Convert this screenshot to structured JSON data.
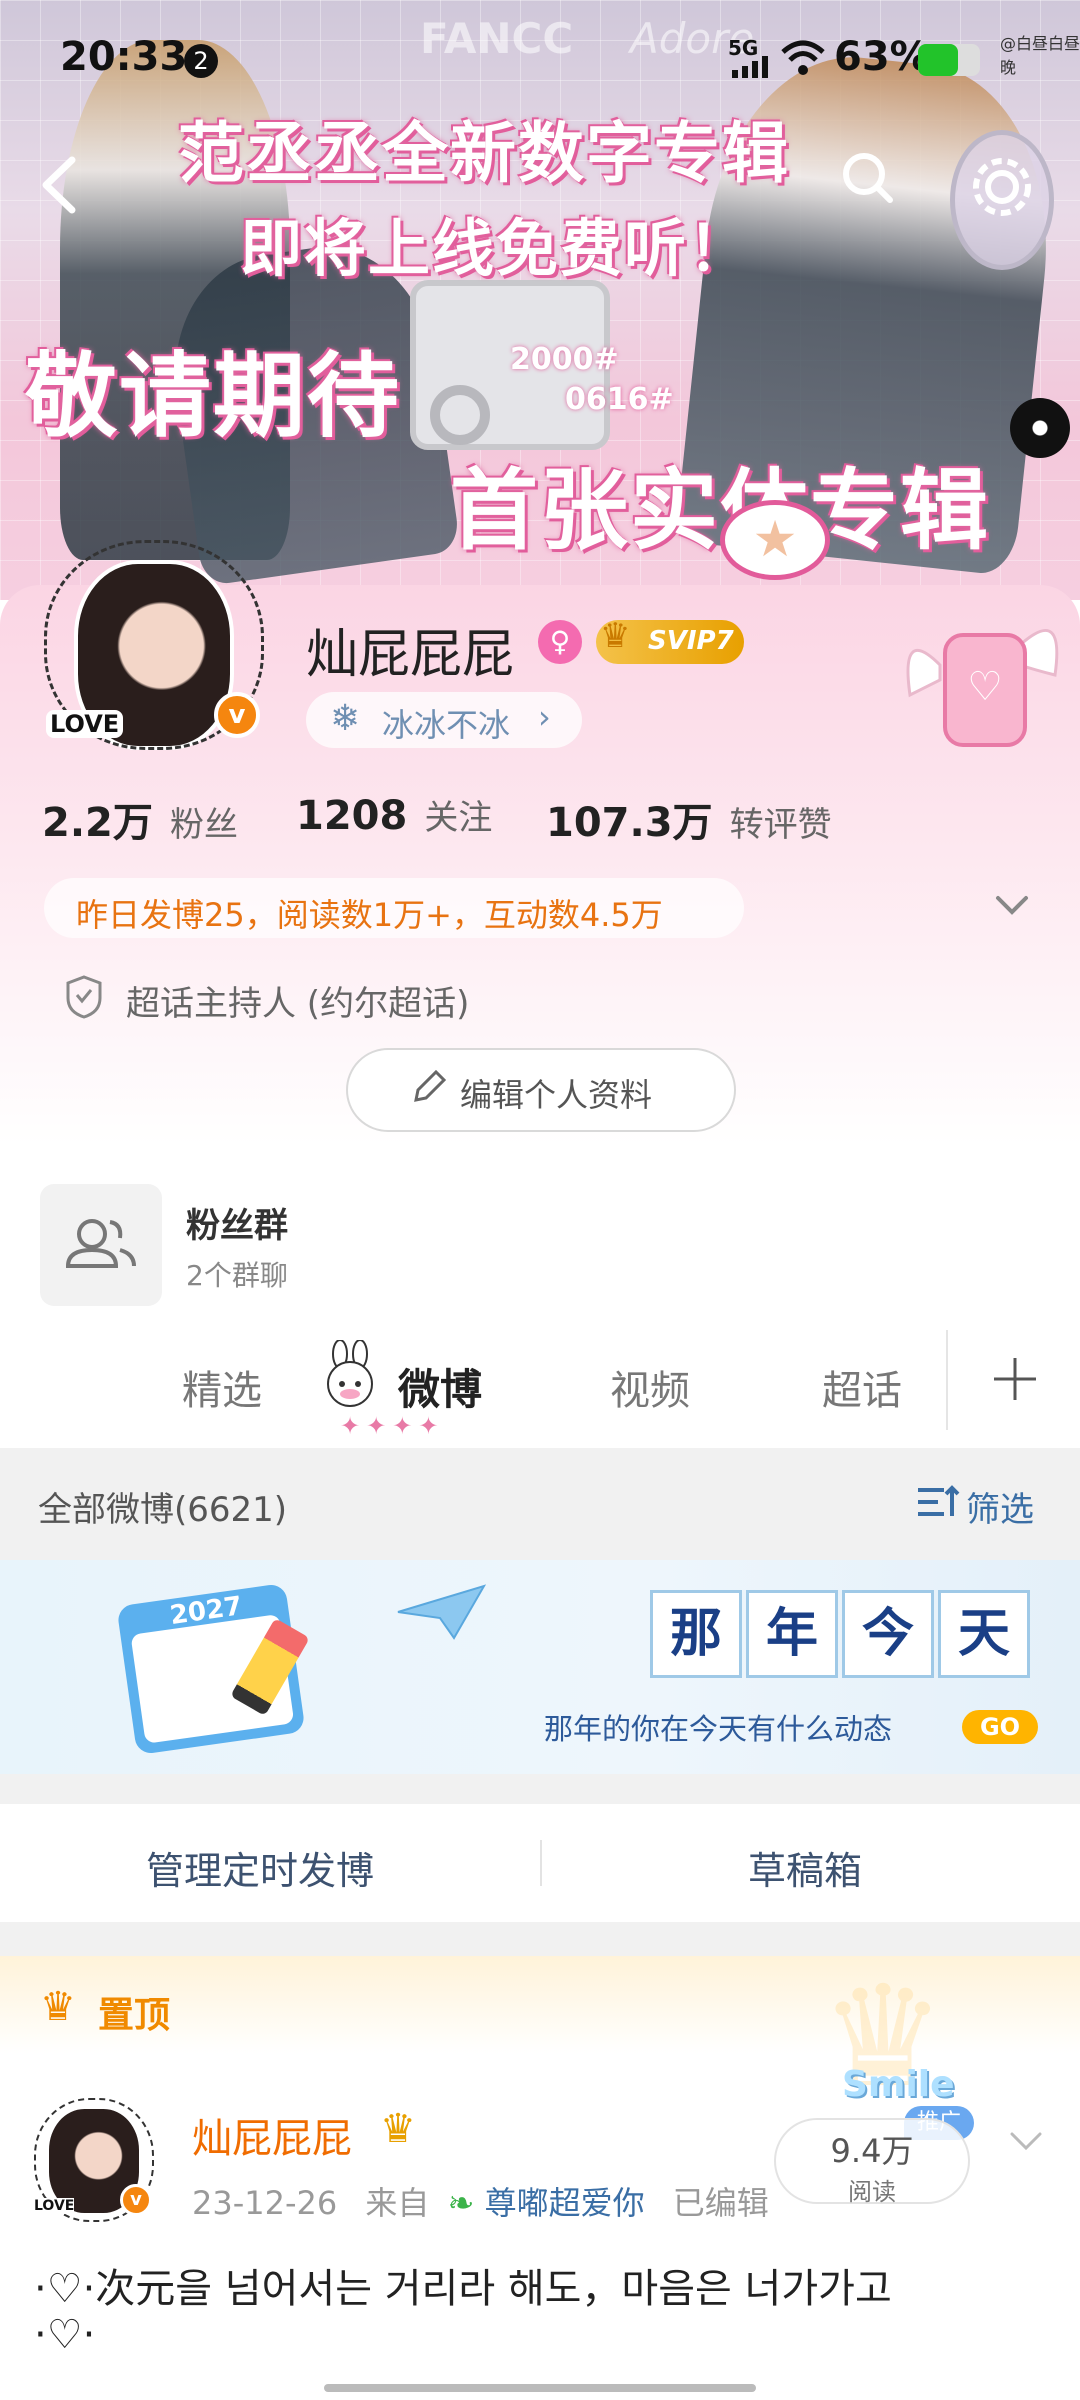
{
  "status_bar": {
    "time": "20:33",
    "notif_count": "2",
    "network": "5G",
    "battery": "63%"
  },
  "banner": {
    "watermark_1": "FANCC",
    "watermark_2": "Adore",
    "headline_1": "范丞丞全新数字专辑",
    "headline_2": "即将上线免费听！",
    "headline_3": "敬请期待",
    "headline_4": "首张实体专辑",
    "tag_1": "2000#",
    "tag_2": "0616#",
    "corner_credit": "@白昼白昼晚"
  },
  "profile": {
    "avatar_sticker": "LOVE",
    "name": "灿屁屁屁",
    "vip_label": "SVIP7",
    "group_badge": "冰冰不冰",
    "stats": [
      {
        "value": "2.2万",
        "label": "粉丝"
      },
      {
        "value": "1208",
        "label": "关注"
      },
      {
        "value": "107.3万",
        "label": "转评赞"
      }
    ],
    "activity": "昨日发博25，阅读数1万+，互动数4.5万",
    "supertopic_role": "超话主持人 (约尔超话)",
    "edit_button": "编辑个人资料"
  },
  "fan_group": {
    "title": "粉丝群",
    "subtitle": "2个群聊"
  },
  "tabs": [
    "精选",
    "微博",
    "视频",
    "超话"
  ],
  "active_tab_index": 1,
  "all_posts": {
    "label": "全部微博(6621)",
    "filter": "筛选"
  },
  "memory_banner": {
    "calendar_year": "2027",
    "chars": [
      "那",
      "年",
      "今",
      "天"
    ],
    "subtitle": "那年的你在今天有什么动态",
    "go": "GO"
  },
  "manage": {
    "scheduled": "管理定时发博",
    "drafts": "草稿箱"
  },
  "pinned": {
    "label": "置顶",
    "author": "灿屁屁屁",
    "avatar_sticker": "LOVE",
    "date": "23-12-26",
    "source_prefix": "来自",
    "source": "尊嘟超爱你",
    "edited": "已编辑",
    "reads_value": "9.4万",
    "reads_label": "阅读",
    "promo_label": "推广",
    "promo_sticker": "Smile",
    "text": "·♡·次元을 넘어서는 거리라 해도，마음은 너가가고",
    "text_line2": "·♡·"
  },
  "colors": {
    "accent_orange": "#f06c00",
    "vip_gold": "#e8a000",
    "link_blue": "#3a6ea5",
    "card_pink": "#fbd5e4"
  }
}
